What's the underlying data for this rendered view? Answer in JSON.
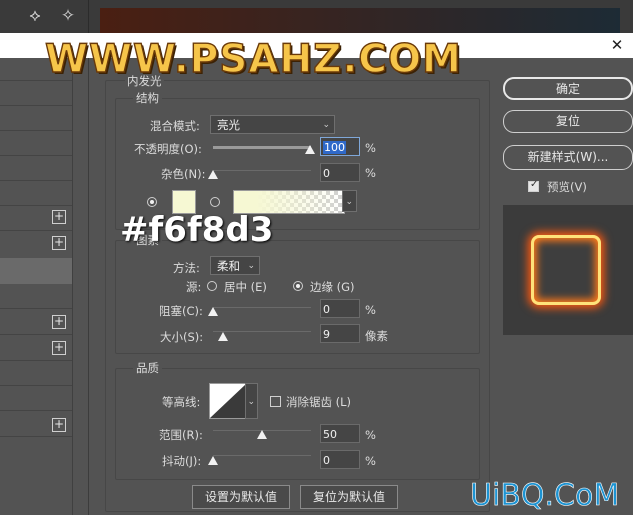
{
  "watermark_top": "WWW.PSAHZ.COM",
  "watermark_bottom": "UiBQ.CoM",
  "overlay_color_label": "#f6f8d3",
  "colors": {
    "glow_color": "#f6f8d3",
    "accent_blue": "#1c93d2"
  },
  "panel_title": "内发光",
  "structure": {
    "title": "结构",
    "blend_mode_label": "混合模式:",
    "blend_mode_value": "亮光",
    "opacity_label": "不透明度(O):",
    "opacity_value": "100",
    "opacity_unit": "%",
    "opacity_level": 100,
    "noise_label": "杂色(N):",
    "noise_value": "0",
    "noise_unit": "%",
    "noise_level": 0
  },
  "elements": {
    "title": "图素",
    "method_label": "方法:",
    "method_value": "柔和",
    "source_label": "源:",
    "source_center": "居中 (E)",
    "source_edge": "边缘 (G)",
    "choke_label": "阻塞(C):",
    "choke_value": "0",
    "choke_unit": "%",
    "size_label": "大小(S):",
    "size_value": "9",
    "size_unit": "像素"
  },
  "quality": {
    "title": "品质",
    "contour_label": "等高线:",
    "antialias_label": "消除锯齿 (L)",
    "range_label": "范围(R):",
    "range_value": "50",
    "range_unit": "%",
    "range_level": 50,
    "jitter_label": "抖动(J):",
    "jitter_value": "0",
    "jitter_unit": "%"
  },
  "buttons": {
    "ok": "确定",
    "reset": "复位",
    "new_style": "新建样式(W)...",
    "preview": "预览(V)",
    "set_default": "设置为默认值",
    "reset_default": "复位为默认值"
  },
  "icons": {
    "tool1": "lasso-icon",
    "tool2": "magic-wand-icon",
    "close": "close-icon"
  }
}
